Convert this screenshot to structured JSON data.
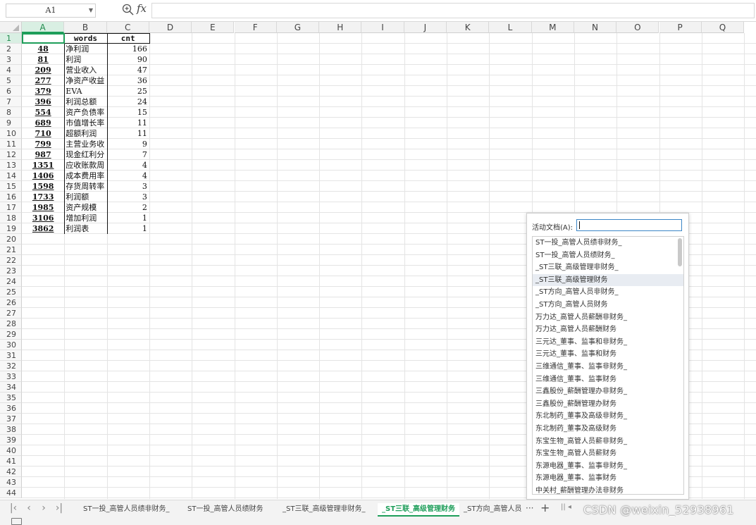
{
  "formula_bar": {
    "name_box": "A1",
    "fx_label": "fx",
    "formula": ""
  },
  "columns": [
    "A",
    "B",
    "C",
    "D",
    "E",
    "F",
    "G",
    "H",
    "I",
    "J",
    "K",
    "L",
    "M",
    "N",
    "O",
    "P",
    "Q"
  ],
  "rows": [
    "1",
    "2",
    "3",
    "4",
    "5",
    "6",
    "7",
    "8",
    "9",
    "10",
    "11",
    "12",
    "13",
    "14",
    "15",
    "16",
    "17",
    "18",
    "19",
    "20",
    "21",
    "22",
    "23",
    "24",
    "25",
    "26",
    "27",
    "28",
    "29",
    "30",
    "31",
    "32",
    "33",
    "34",
    "35",
    "36",
    "37",
    "38",
    "39",
    "40",
    "41",
    "42",
    "43",
    "44"
  ],
  "table": {
    "headers": [
      "",
      "words",
      "cnt"
    ],
    "rows": [
      [
        "48",
        "净利润",
        "166"
      ],
      [
        "81",
        "利润",
        "90"
      ],
      [
        "209",
        "营业收入",
        "47"
      ],
      [
        "277",
        "净资产收益",
        "36"
      ],
      [
        "379",
        "EVA",
        "25"
      ],
      [
        "396",
        "利润总额",
        "24"
      ],
      [
        "554",
        "资产负债率",
        "15"
      ],
      [
        "689",
        "市值增长率",
        "11"
      ],
      [
        "710",
        "超额利润",
        "11"
      ],
      [
        "799",
        "主营业务收",
        "9"
      ],
      [
        "987",
        "现金红利分",
        "7"
      ],
      [
        "1351",
        "应收账款周",
        "4"
      ],
      [
        "1406",
        "成本费用率",
        "4"
      ],
      [
        "1598",
        "存货周转率",
        "3"
      ],
      [
        "1733",
        "利润额",
        "3"
      ],
      [
        "1985",
        "资产规模",
        "2"
      ],
      [
        "3106",
        "增加利润",
        "1"
      ],
      [
        "3862",
        "利润表",
        "1"
      ]
    ]
  },
  "popup": {
    "label": "活动文档(A):",
    "input_value": "",
    "items": [
      "ST一投_高管人员绩非财务_",
      "ST一投_高管人员绩财务_",
      "_ST三联_高级管理非财务_",
      "_ST三联_高级管理财务",
      "_ST方向_高管人员非财务_",
      "_ST方向_高管人员财务",
      "万力达_高管人员薪酬非财务_",
      "万力达_高管人员薪酬财务",
      "三元达_董事、监事和非财务_",
      "三元达_董事、监事和财务",
      "三维通信_董事、监事非财务_",
      "三维通信_董事、监事财务",
      "三鑫股份_薪酬管理办非财务_",
      "三鑫股份_薪酬管理办财务",
      "东北制药_董事及高级非财务_",
      "东北制药_董事及高级财务",
      "东宝生物_高管人员薪非财务_",
      "东宝生物_高管人员薪财务",
      "东源电器_董事、监事非财务_",
      "东源电器_董事、监事财务",
      "中关村_薪酬管理办法非财务"
    ],
    "selected_index": 3
  },
  "sheet_tabs": {
    "tabs": [
      "ST一投_高管人员绩非财务_",
      "ST一投_高管人员绩财务",
      "_ST三联_高级管理非财务_",
      "_ST三联_高级管理财务",
      "_ST方向_高管人员"
    ],
    "active_index": 3,
    "more": "···",
    "add": "+"
  },
  "watermark": "CSDN @weixin_52938961",
  "colors": {
    "accent": "#1e9e5a",
    "selection_bg": "#d9efe3"
  }
}
